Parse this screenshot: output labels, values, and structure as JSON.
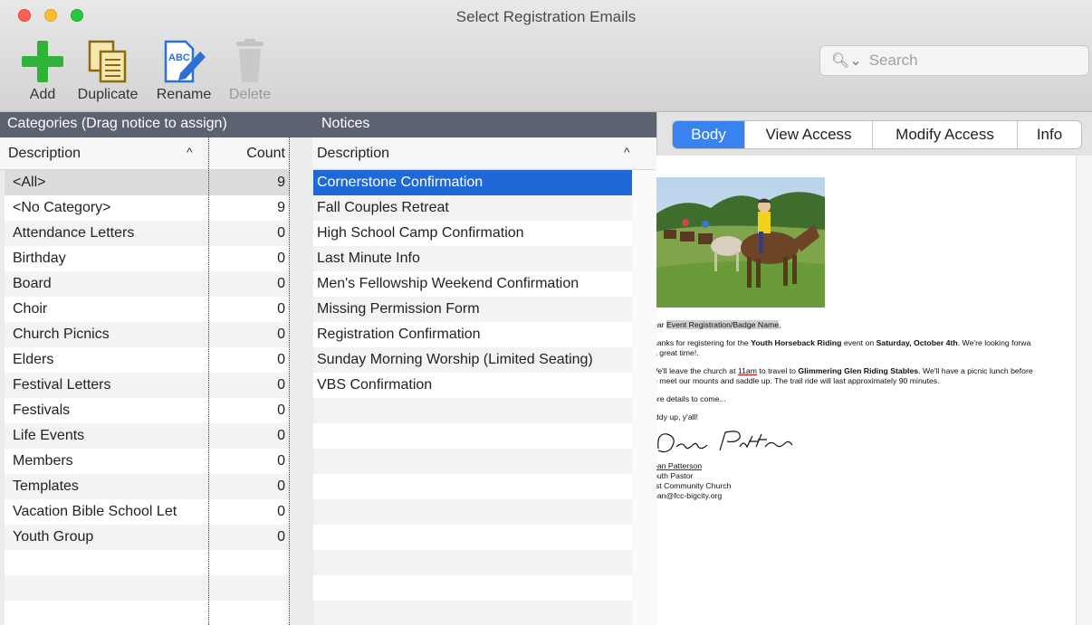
{
  "window": {
    "title": "Select Registration Emails"
  },
  "toolbar": {
    "add_label": "Add",
    "duplicate_label": "Duplicate",
    "rename_label": "Rename",
    "delete_label": "Delete"
  },
  "search": {
    "placeholder": "Search"
  },
  "categories": {
    "header": "Categories (Drag notice to assign)",
    "col_description": "Description",
    "col_count": "Count",
    "items": [
      {
        "label": "<All>",
        "count": "9"
      },
      {
        "label": "<No Category>",
        "count": "9"
      },
      {
        "label": "Attendance Letters",
        "count": "0"
      },
      {
        "label": "Birthday",
        "count": "0"
      },
      {
        "label": "Board",
        "count": "0"
      },
      {
        "label": "Choir",
        "count": "0"
      },
      {
        "label": "Church Picnics",
        "count": "0"
      },
      {
        "label": "Elders",
        "count": "0"
      },
      {
        "label": "Festival Letters",
        "count": "0"
      },
      {
        "label": "Festivals",
        "count": "0"
      },
      {
        "label": "Life Events",
        "count": "0"
      },
      {
        "label": "Members",
        "count": "0"
      },
      {
        "label": "Templates",
        "count": "0"
      },
      {
        "label": "Vacation Bible School Let",
        "count": "0"
      },
      {
        "label": "Youth Group",
        "count": "0"
      }
    ]
  },
  "notices": {
    "header": "Notices",
    "col_description": "Description",
    "items": [
      "Cornerstone Confirmation",
      "Fall Couples Retreat",
      "High School Camp Confirmation",
      "Last Minute Info",
      "Men's Fellowship Weekend Confirmation",
      "Missing Permission Form",
      "Registration Confirmation",
      "Sunday Morning Worship (Limited Seating)",
      "VBS Confirmation"
    ]
  },
  "tabs": {
    "body": "Body",
    "view_access": "View Access",
    "modify_access": "Modify Access",
    "info": "Info"
  },
  "email": {
    "greeting_prefix": "ear ",
    "greeting_field": "Event Registration/Badge Name",
    "greeting_suffix": ",",
    "p1_a": "hanks for registering for the ",
    "p1_event": "Youth Horseback Riding",
    "p1_b": " event on ",
    "p1_date": "Saturday, October 4th",
    "p1_c": ". We're looking forwa",
    "p1_line2": "a great time!.",
    "p2_a": "Ve'll leave the church at ",
    "p2_time": "11am",
    "p2_b": " to travel to ",
    "p2_place": "Glimmering Glen Riding Stables",
    "p2_c": ". We'll have a picnic lunch before",
    "p2_line2": "e meet our mounts and saddle up. The trail ride will last approximately 90 minutes.",
    "p3": "ore details to come...",
    "p4": "iddy up, y'all!",
    "signature_script": "Dean Patterson",
    "sig_name": "ean Patterson",
    "sig_title": "outh Pastor",
    "sig_church": "rst Community Church",
    "sig_email": "ean@fcc-bigcity.org"
  }
}
